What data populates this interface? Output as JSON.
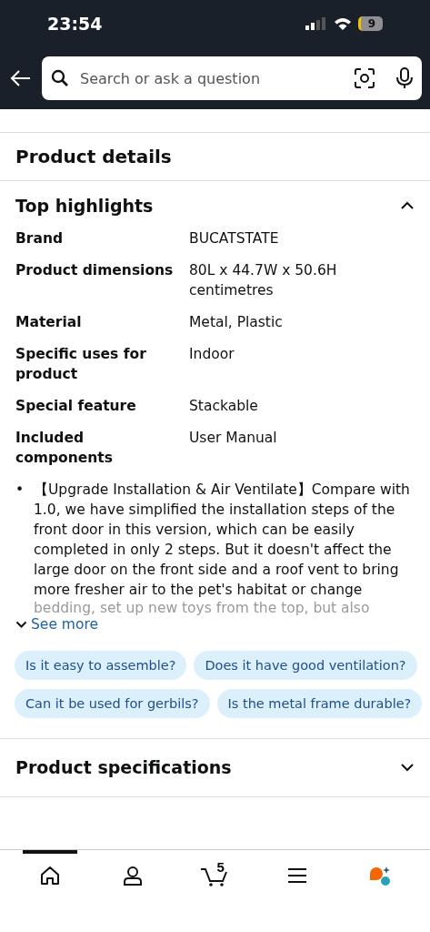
{
  "status_bar": {
    "time": "23:54",
    "battery": "9"
  },
  "search": {
    "placeholder": "Search or ask a question"
  },
  "title": "Product details",
  "highlights": {
    "title": "Top highlights",
    "expanded": true,
    "rows": [
      {
        "label": "Brand",
        "value": "BUCATSTATE"
      },
      {
        "label": "Product dimensions",
        "value": "80L x 44.7W x 50.6H centimetres"
      },
      {
        "label": "Material",
        "value": "Metal, Plastic"
      },
      {
        "label": "Specific uses for product",
        "value": "Indoor"
      },
      {
        "label": "Special feature",
        "value": "Stackable"
      },
      {
        "label": "Included components",
        "value": "User Manual"
      }
    ],
    "bullet_marker": "•",
    "bullets": [
      "【Upgrade Installation & Air Ventilate】Compare with 1.0, we have simplified the installation steps of the front door in this version, which can be easily completed in only 2 steps. But it doesn't affect the large door on the front side and a roof vent to bring more fresher air to the pet's habitat or change"
    ],
    "faded_line": "bedding, set up new toys from the top, but also",
    "see_more": "See more"
  },
  "questions": [
    "Is it easy to assemble?",
    "Does it have good ventilation?",
    "Can it be used for gerbils?",
    "Is the metal frame durable?"
  ],
  "specifications": {
    "title": "Product specifications",
    "expanded": false
  },
  "nav": [
    {
      "kind": "home",
      "selected": true
    },
    {
      "kind": "account",
      "selected": false
    },
    {
      "kind": "cart",
      "badge": "5",
      "selected": false
    },
    {
      "kind": "menu",
      "selected": false
    },
    {
      "kind": "assistant",
      "selected": false
    }
  ]
}
